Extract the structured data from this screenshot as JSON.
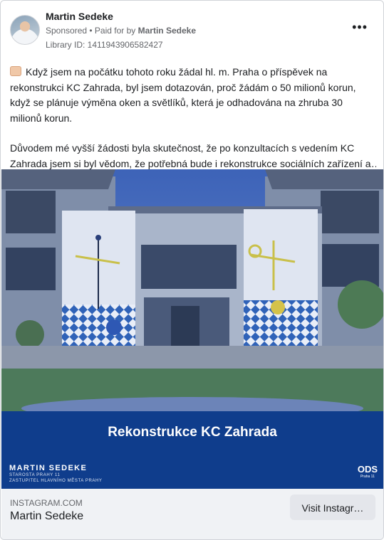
{
  "header": {
    "advertiser": "Martin Sedeke",
    "sponsored_label": "Sponsored",
    "paid_for_prefix": " • Paid for by ",
    "paid_for_by": "Martin Sedeke",
    "library_id": "Library ID: 1411943906582427"
  },
  "more_icon": "•••",
  "body": {
    "paragraph1": "Když jsem na počátku tohoto roku žádal hl. m. Praha o příspěvek na rekonstrukci KC Zahrada, byl jsem dotazován, proč žádám o 50 milionů korun, když se plánuje výměna oken a světlíků, která je odhadována na zhruba 30 milionů korun.",
    "paragraph2_line1": "Důvodem mé vyšší žádosti byla skutečnost, že po konzultacích s vedením KC",
    "paragraph2_line2": "Zahrada jsem si byl vědom, že potřebná bude i rekonstrukce sociálních zařízení a…"
  },
  "creative": {
    "title": "Rekonstrukce KC Zahrada",
    "signature_name": "MARTIN SEDEKE",
    "signature_line1": "STAROSTA PRAHY 11",
    "signature_line2": "ZASTUPITEL HLAVNÍHO MĚSTA PRAHY",
    "party_logo": "ODS",
    "party_logo_sub": "Praha 11"
  },
  "footer": {
    "domain": "INSTAGRAM.COM",
    "name": "Martin Sedeke",
    "cta_label": "Visit Instagr…"
  },
  "colors": {
    "banner": "#0f3d8c",
    "footer_bg": "#f0f2f5",
    "cta_bg": "#e4e6eb"
  }
}
